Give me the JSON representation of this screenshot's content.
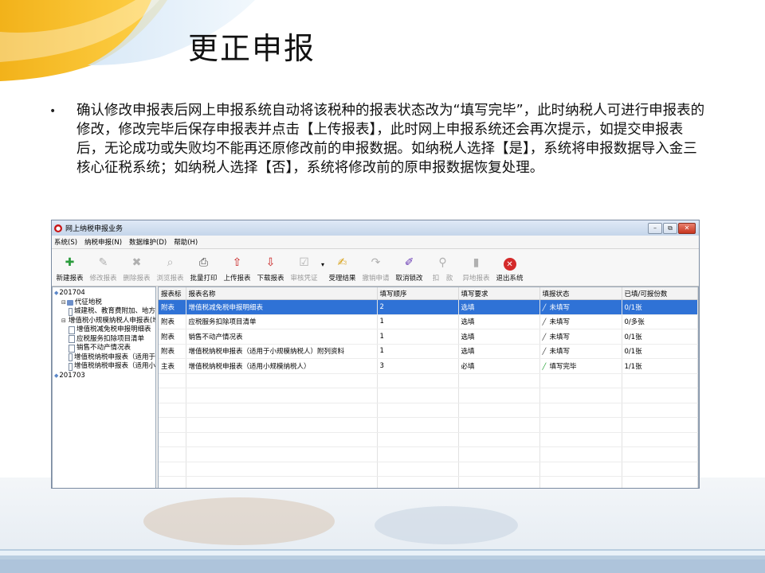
{
  "slide": {
    "title": "更正申报",
    "bullet": "•",
    "body": "确认修改申报表后网上申报系统自动将该税种的报表状态改为“填写完毕”，此时纳税人可进行申报表的修改，修改完毕后保存申报表并点击【上传报表】，此时网上申报系统还会再次提示，如提交申报表后，无论成功或失败均不能再还原修改前的申报数据。如纳税人选择【是】，系统将申报数据导入金三核心征税系统；如纳税人选择【否】，系统将修改前的原申报数据恢复处理。"
  },
  "window": {
    "title": "网上纳税申报业务",
    "buttons": {
      "minimize": "–",
      "maximize": "⧉",
      "close": "✕"
    },
    "menu": [
      "系统(S)",
      "纳税申报(N)",
      "数据维护(D)",
      "帮助(H)"
    ],
    "toolbar": [
      {
        "label": "新建报表",
        "icon": "new-report-icon",
        "enabled": true
      },
      {
        "label": "修改报表",
        "icon": "edit-report-icon",
        "enabled": false
      },
      {
        "label": "删除报表",
        "icon": "delete-report-icon",
        "enabled": false
      },
      {
        "label": "浏览报表",
        "icon": "browse-report-icon",
        "enabled": false
      },
      {
        "label": "批量打印",
        "icon": "print-icon",
        "enabled": true
      },
      {
        "label": "上传报表",
        "icon": "upload-icon",
        "enabled": true
      },
      {
        "label": "下载报表",
        "icon": "download-icon",
        "enabled": true
      },
      {
        "label": "审核凭证",
        "icon": "check-icon",
        "enabled": false
      },
      {
        "label": "受理结果",
        "icon": "result-icon",
        "enabled": true
      },
      {
        "label": "撤销申请",
        "icon": "undo-icon",
        "enabled": false
      },
      {
        "label": "取消锁改",
        "icon": "unlock-icon",
        "enabled": true
      },
      {
        "label": "扣　款",
        "icon": "deduct-icon",
        "enabled": false
      },
      {
        "label": "异地报表",
        "icon": "remote-report-icon",
        "enabled": false
      },
      {
        "label": "退出系统",
        "icon": "exit-icon",
        "enabled": true
      }
    ],
    "tree": [
      {
        "label": "201704",
        "level": 0,
        "type": "root"
      },
      {
        "label": "代征地税",
        "level": 1,
        "type": "folder"
      },
      {
        "label": "城建税、教育费附加、地方",
        "level": 2,
        "type": "doc"
      },
      {
        "label": "增值税小规模纳税人申报表(增",
        "level": 1,
        "type": "folder"
      },
      {
        "label": "增值税减免税申报明细表",
        "level": 2,
        "type": "doc"
      },
      {
        "label": "应税服务扣除项目清单",
        "level": 2,
        "type": "doc"
      },
      {
        "label": "销售不动产情况表",
        "level": 2,
        "type": "doc"
      },
      {
        "label": "增值税纳税申报表（适用于",
        "level": 2,
        "type": "doc"
      },
      {
        "label": "增值税纳税申报表（适用小",
        "level": 2,
        "type": "doc"
      },
      {
        "label": "201703",
        "level": 0,
        "type": "root"
      }
    ],
    "table": {
      "columns": [
        "报表标",
        "报表名称",
        "填写顺序",
        "填写要求",
        "填报状态",
        "已填/可报份数"
      ],
      "rows": [
        {
          "tag": "附表",
          "name": "增值税减免税申报明细表",
          "order": "2",
          "req": "选填",
          "status": "未填写",
          "count": "0/1张",
          "done": false,
          "selected": true
        },
        {
          "tag": "附表",
          "name": "应税服务扣除项目清单",
          "order": "1",
          "req": "选填",
          "status": "未填写",
          "count": "0/多张",
          "done": false,
          "selected": false
        },
        {
          "tag": "附表",
          "name": "销售不动产情况表",
          "order": "1",
          "req": "选填",
          "status": "未填写",
          "count": "0/1张",
          "done": false,
          "selected": false
        },
        {
          "tag": "附表",
          "name": "增值税纳税申报表（适用于小规模纳税人）附列资料",
          "order": "1",
          "req": "选填",
          "status": "未填写",
          "count": "0/1张",
          "done": false,
          "selected": false
        },
        {
          "tag": "主表",
          "name": "增值税纳税申报表（适用小规模纳税人）",
          "order": "3",
          "req": "必填",
          "status": "填写完毕",
          "count": "1/1张",
          "done": true,
          "selected": false
        }
      ],
      "empty_rows": 9
    }
  }
}
